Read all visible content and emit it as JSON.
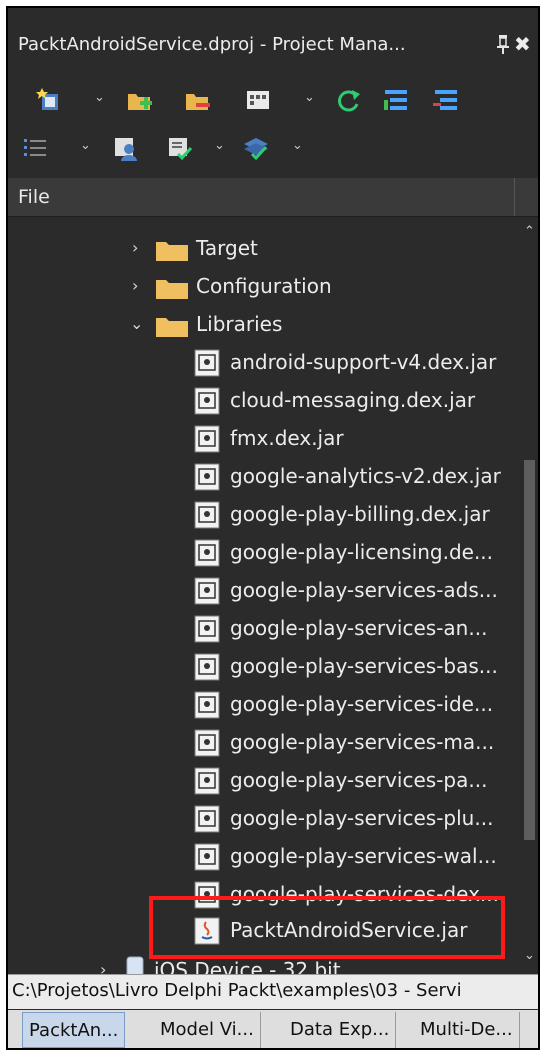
{
  "window": {
    "title": "PacktAndroidService.dproj - Project Mana...",
    "pin_icon": "pin-icon",
    "close_icon": "close-icon"
  },
  "toolbar_row1": [
    "new-item-icon",
    "add-folder-icon",
    "remove-folder-icon",
    "view-icon",
    "refresh-icon",
    "expand-icon",
    "collapse-icon"
  ],
  "toolbar_row2": [
    "build-order-icon",
    "user-icon",
    "deploy-icon",
    "layers-icon"
  ],
  "column_header": {
    "label": "File"
  },
  "tree": {
    "target_label": "Target",
    "configuration_label": "Configuration",
    "libraries_label": "Libraries",
    "files": [
      "android-support-v4.dex.jar",
      "cloud-messaging.dex.jar",
      "fmx.dex.jar",
      "google-analytics-v2.dex.jar",
      "google-play-billing.dex.jar",
      "google-play-licensing.de...",
      "google-play-services-ads...",
      "google-play-services-an...",
      "google-play-services-bas...",
      "google-play-services-ide...",
      "google-play-services-ma...",
      "google-play-services-pa...",
      "google-play-services-plu...",
      "google-play-services-wal...",
      "google-play-services-dex..."
    ],
    "highlighted_file": "PacktAndroidService.jar",
    "ios_label": "iOS Device - 32 bit"
  },
  "status": {
    "path": "C:\\Projetos\\Livro Delphi Packt\\examples\\03 - Servi"
  },
  "tabs": {
    "t1": "PacktAn...",
    "t2": "Model Vi...",
    "t3": "Data Exp...",
    "t4": "Multi-De..."
  },
  "colors": {
    "background": "#2b2b2b",
    "highlight": "#ff1a1a",
    "folder": "#f0c060"
  }
}
